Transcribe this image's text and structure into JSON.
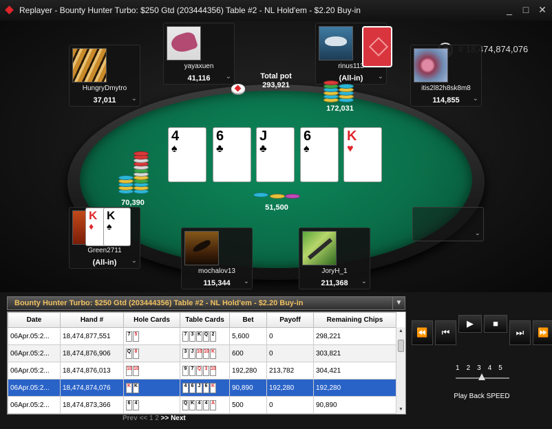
{
  "window": {
    "title": "Replayer - Bounty Hunter Turbo: $250 Gtd (203444356) Table #2 -  NL  Hold'em - $2.20 Buy-in",
    "minimize": "_",
    "maximize": "□",
    "close": "✕"
  },
  "table": {
    "hand_number": "# 18,474,874,076",
    "pot_label": "Total pot",
    "pot_amount": "293,921",
    "board": [
      {
        "rank": "4",
        "suit": "♠",
        "color": "#000000"
      },
      {
        "rank": "6",
        "suit": "♣",
        "color": "#000000"
      },
      {
        "rank": "J",
        "suit": "♣",
        "color": "#000000"
      },
      {
        "rank": "6",
        "suit": "♠",
        "color": "#000000"
      },
      {
        "rank": "K",
        "suit": "♥",
        "color": "#e0262b"
      }
    ],
    "bets": {
      "left": "70,390",
      "center": "51,500",
      "top_right": "172,031"
    }
  },
  "seats": {
    "hungry": {
      "name": "HungryDmytro",
      "stack": "37,011",
      "avatar": "tiger-avatar"
    },
    "yaya": {
      "name": "yayaxuen",
      "stack": "41,116",
      "avatar": "shoe-avatar"
    },
    "rinus": {
      "name": "rinus113",
      "stack": "(All-in)",
      "avatar": "shark-avatar"
    },
    "itis": {
      "name": "itis2l82h8sk8m8",
      "stack": "114,855",
      "avatar": "flower-avatar"
    },
    "green": {
      "name": "Green2711",
      "stack": "(All-in)",
      "avatar": "red-avatar",
      "hole_cards": [
        {
          "rank": "K",
          "suit": "♦",
          "color": "#e0262b"
        },
        {
          "rank": "K",
          "suit": "♠",
          "color": "#000000"
        }
      ]
    },
    "mochalov": {
      "name": "mochalov13",
      "stack": "115,344",
      "avatar": "dolphin-avatar"
    },
    "joryh": {
      "name": "JoryH_1",
      "stack": "211,368",
      "avatar": "snake-avatar"
    }
  },
  "history": {
    "title": "Bounty Hunter Turbo: $250 Gtd (203444356) Table #2 -  NL  Hold'em - $2.20 Buy-in",
    "columns": [
      "Date",
      "Hand #",
      "Hole Cards",
      "Table Cards",
      "Bet",
      "Payoff",
      "Remaining Chips"
    ],
    "rows": [
      {
        "date": "06Apr.05:2...",
        "hand": "18,474,877,551",
        "hole": [
          [
            "7",
            "s"
          ],
          [
            "5",
            "h"
          ]
        ],
        "table": [
          [
            "7",
            "s"
          ],
          [
            "3",
            "s"
          ],
          [
            "K",
            "c"
          ],
          [
            "Q",
            "s"
          ],
          [
            "2",
            "c"
          ]
        ],
        "bet": "5,600",
        "payoff": "0",
        "remaining": "298,221"
      },
      {
        "date": "06Apr.05:2...",
        "hand": "18,474,876,906",
        "hole": [
          [
            "Q",
            "s"
          ],
          [
            "8",
            "h"
          ]
        ],
        "table": [
          [
            "3",
            "s"
          ],
          [
            "J",
            "c"
          ],
          [
            "10",
            "h"
          ],
          [
            "10",
            "h"
          ],
          [
            "K",
            "h"
          ]
        ],
        "bet": "600",
        "payoff": "0",
        "remaining": "303,821"
      },
      {
        "date": "06Apr.05:2...",
        "hand": "18,474,876,013",
        "hole": [
          [
            "10",
            "h"
          ],
          [
            "10",
            "h"
          ]
        ],
        "table": [
          [
            "9",
            "s"
          ],
          [
            "7",
            "c"
          ],
          [
            "Q",
            "h"
          ],
          [
            "3",
            "h"
          ],
          [
            "10",
            "h"
          ]
        ],
        "bet": "192,280",
        "payoff": "213,782",
        "remaining": "304,421"
      },
      {
        "date": "06Apr.05:2...",
        "hand": "18,474,874,076",
        "hole": [
          [
            "K",
            "h"
          ],
          [
            "K",
            "s"
          ]
        ],
        "table": [
          [
            "4",
            "s"
          ],
          [
            "6",
            "c"
          ],
          [
            "J",
            "c"
          ],
          [
            "6",
            "s"
          ],
          [
            "K",
            "h"
          ]
        ],
        "bet": "90,890",
        "payoff": "192,280",
        "remaining": "192,280"
      },
      {
        "date": "06Apr.05:2...",
        "hand": "18,474,873,366",
        "hole": [
          [
            "6",
            "s"
          ],
          [
            "4",
            "s"
          ]
        ],
        "table": [
          [
            "Q",
            "s"
          ],
          [
            "K",
            "s"
          ],
          [
            "4",
            "s"
          ],
          [
            "4",
            "s"
          ],
          [
            "A",
            "h"
          ]
        ],
        "bet": "500",
        "payoff": "0",
        "remaining": "90,890"
      }
    ],
    "selected_row": 3,
    "pager_prev": "Prev <<",
    "pager_pages": "1 2",
    "pager_next": ">> Next"
  },
  "playback": {
    "buttons": [
      "⏪",
      "⏮",
      "▶",
      "■",
      "⏭",
      "⏩"
    ],
    "speed_values": [
      "1",
      "2",
      "3",
      "4",
      "5"
    ],
    "speed_selected": 3,
    "speed_label": "Play Back SPEED"
  }
}
